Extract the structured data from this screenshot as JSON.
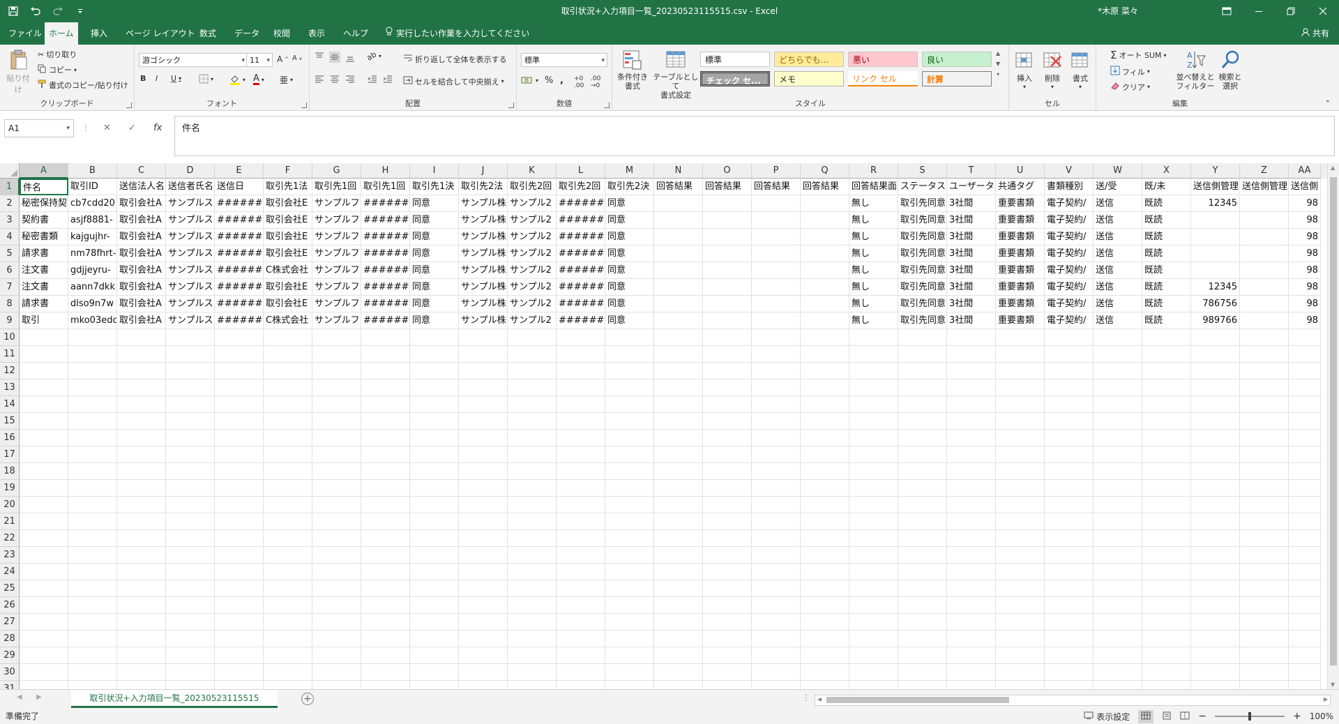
{
  "window": {
    "title": "取引状況+入力項目一覧_20230523115515.csv  -  Excel",
    "user": "*木原 菜々"
  },
  "tabs": [
    {
      "label": "ファイル"
    },
    {
      "label": "ホーム"
    },
    {
      "label": "挿入"
    },
    {
      "label": "ページ レイアウト"
    },
    {
      "label": "数式"
    },
    {
      "label": "データ"
    },
    {
      "label": "校閲"
    },
    {
      "label": "表示"
    },
    {
      "label": "ヘルプ"
    }
  ],
  "tellme": "実行したい作業を入力してください",
  "share_label": "共有",
  "ribbon": {
    "clipboard": {
      "paste": "貼り付け",
      "cut": "切り取り",
      "copy": "コピー",
      "format_painter": "書式のコピー/貼り付け",
      "group": "クリップボード"
    },
    "font": {
      "name": "游ゴシック",
      "size": "11",
      "group": "フォント"
    },
    "alignment": {
      "wrap": "折り返して全体を表示する",
      "merge": "セルを結合して中央揃え",
      "group": "配置"
    },
    "number": {
      "format": "標準",
      "group": "数値"
    },
    "styles": {
      "conditional": "条件付き\n書式",
      "table": "テーブルとして\n書式設定",
      "cells": [
        "標準",
        "どちらでも...",
        "悪い",
        "良い",
        "チェック セ...",
        "メモ",
        "リンク セル",
        "計算"
      ],
      "group": "スタイル"
    },
    "cells_group": {
      "insert": "挿入",
      "delete": "削除",
      "format": "書式",
      "group": "セル"
    },
    "editing": {
      "autosum": "オート SUM",
      "fill": "フィル",
      "clear": "クリア",
      "sort": "並べ替えと\nフィルター",
      "find": "検索と\n選択",
      "group": "編集"
    }
  },
  "formula_bar": {
    "namebox": "A1",
    "formula": "件名"
  },
  "columns": [
    "A",
    "B",
    "C",
    "D",
    "E",
    "F",
    "G",
    "H",
    "I",
    "J",
    "K",
    "L",
    "M",
    "N",
    "O",
    "P",
    "Q",
    "R",
    "S",
    "T",
    "U",
    "V",
    "W",
    "X",
    "Y",
    "Z",
    "AA"
  ],
  "rows_count": 31,
  "table": [
    [
      "件名",
      "取引ID",
      "送信法人名",
      "送信者氏名",
      "送信日",
      "取引先1法",
      "取引先1回",
      "取引先1回",
      "取引先1決",
      "取引先2法",
      "取引先2回",
      "取引先2回",
      "取引先2決",
      "回答結果",
      "回答結果",
      "回答結果",
      "回答結果",
      "回答結果面",
      "ステータス",
      "ユーザータ",
      "共通タグ",
      "書類種別",
      "送/受",
      "既/未",
      "送信側管理",
      "送信側管理",
      "送信側"
    ],
    [
      "秘密保持契",
      "cb7cdd20",
      "取引会社A",
      "サンプルス",
      "#######",
      "取引会社E",
      "サンプルフ",
      "#######",
      "同意",
      "サンプル株",
      "サンプル2",
      "#######",
      "同意",
      "",
      "",
      "",
      "",
      "無し",
      "取引先同意",
      "3社間",
      "重要書類",
      "電子契約/",
      "送信",
      "既読",
      "12345",
      "",
      "98"
    ],
    [
      "契約書",
      "asjf8881-",
      "取引会社A",
      "サンプルス",
      "#######",
      "取引会社E",
      "サンプルフ",
      "#######",
      "同意",
      "サンプル株",
      "サンプル2",
      "#######",
      "同意",
      "",
      "",
      "",
      "",
      "無し",
      "取引先同意",
      "3社間",
      "重要書類",
      "電子契約/",
      "送信",
      "既読",
      "",
      "",
      "98"
    ],
    [
      "秘密書類",
      "kajgujhr-",
      "取引会社A",
      "サンプルス",
      "#######",
      "取引会社E",
      "サンプルフ",
      "#######",
      "同意",
      "サンプル株",
      "サンプル2",
      "#######",
      "同意",
      "",
      "",
      "",
      "",
      "無し",
      "取引先同意",
      "3社間",
      "重要書類",
      "電子契約/",
      "送信",
      "既読",
      "",
      "",
      "98"
    ],
    [
      "請求書",
      "nm78fhrt-",
      "取引会社A",
      "サンプルス",
      "#######",
      "取引会社E",
      "サンプルフ",
      "#######",
      "同意",
      "サンプル株",
      "サンプル2",
      "#######",
      "同意",
      "",
      "",
      "",
      "",
      "無し",
      "取引先同意",
      "3社間",
      "重要書類",
      "電子契約/",
      "送信",
      "既読",
      "",
      "",
      "98"
    ],
    [
      "注文書",
      "gdjjeyru-",
      "取引会社A",
      "サンプルス",
      "#######",
      "C株式会社",
      "サンプルフ",
      "#######",
      "同意",
      "サンプル株",
      "サンプル2",
      "#######",
      "同意",
      "",
      "",
      "",
      "",
      "無し",
      "取引先同意",
      "3社間",
      "重要書類",
      "電子契約/",
      "送信",
      "既読",
      "",
      "",
      "98"
    ],
    [
      "注文書",
      "aann7dkk",
      "取引会社A",
      "サンプルス",
      "#######",
      "取引会社E",
      "サンプルフ",
      "#######",
      "同意",
      "サンプル株",
      "サンプル2",
      "#######",
      "同意",
      "",
      "",
      "",
      "",
      "無し",
      "取引先同意",
      "3社間",
      "重要書類",
      "電子契約/",
      "送信",
      "既読",
      "12345",
      "",
      "98"
    ],
    [
      "請求書",
      "dlso9n7w",
      "取引会社A",
      "サンプルス",
      "#######",
      "取引会社E",
      "サンプルフ",
      "#######",
      "同意",
      "サンプル株",
      "サンプル2",
      "#######",
      "同意",
      "",
      "",
      "",
      "",
      "無し",
      "取引先同意",
      "3社間",
      "重要書類",
      "電子契約/",
      "送信",
      "既読",
      "786756",
      "",
      "98"
    ],
    [
      "取引",
      "mko03edc",
      "取引会社A",
      "サンプルス",
      "#######",
      "C株式会社",
      "サンプルフ",
      "#######",
      "同意",
      "サンプル株",
      "サンプル2",
      "#######",
      "同意",
      "",
      "",
      "",
      "",
      "無し",
      "取引先同意",
      "3社間",
      "重要書類",
      "電子契約/",
      "送信",
      "既読",
      "989766",
      "",
      "98"
    ]
  ],
  "sheet_tab": "取引状況+入力項目一覧_20230523115515",
  "status": {
    "ready": "準備完了",
    "display_settings": "表示設定",
    "zoom": "100%"
  }
}
